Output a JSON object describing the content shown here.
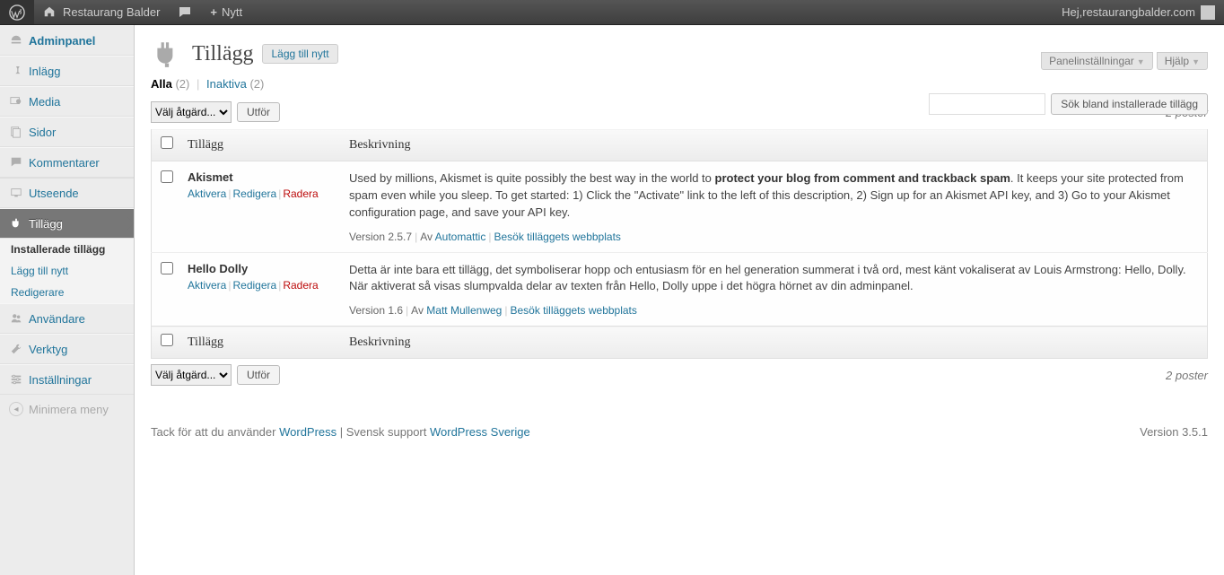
{
  "adminbar": {
    "site_name": "Restaurang Balder",
    "new_label": "Nytt",
    "howdy_prefix": "Hej, ",
    "user_display": "restaurangbalder.com"
  },
  "sidebar": {
    "items": [
      {
        "id": "dashboard",
        "label": "Adminpanel",
        "icon": "dashboard-icon"
      },
      {
        "id": "posts",
        "label": "Inlägg",
        "icon": "pin-icon"
      },
      {
        "id": "media",
        "label": "Media",
        "icon": "media-icon"
      },
      {
        "id": "pages",
        "label": "Sidor",
        "icon": "pages-icon"
      },
      {
        "id": "comments",
        "label": "Kommentarer",
        "icon": "comments-icon"
      },
      {
        "id": "appearance",
        "label": "Utseende",
        "icon": "appearance-icon"
      },
      {
        "id": "plugins",
        "label": "Tillägg",
        "icon": "plugins-icon",
        "current": true
      },
      {
        "id": "users",
        "label": "Användare",
        "icon": "users-icon"
      },
      {
        "id": "tools",
        "label": "Verktyg",
        "icon": "tools-icon"
      },
      {
        "id": "settings",
        "label": "Inställningar",
        "icon": "settings-icon"
      }
    ],
    "plugins_submenu": {
      "installed": "Installerade tillägg",
      "add_new": "Lägg till nytt",
      "editor": "Redigerare"
    },
    "collapse_label": "Minimera meny"
  },
  "screen_meta": {
    "screen_options": "Panelinställningar",
    "help": "Hjälp"
  },
  "header": {
    "title": "Tillägg",
    "add_new": "Lägg till nytt"
  },
  "filters": {
    "all_label": "Alla",
    "all_count": "(2)",
    "inactive_label": "Inaktiva",
    "inactive_count": "(2)"
  },
  "search": {
    "button": "Sök bland installerade tillägg"
  },
  "bulk": {
    "select_placeholder": "Välj åtgärd...",
    "apply": "Utför"
  },
  "table": {
    "col_plugin": "Tillägg",
    "col_desc": "Beskrivning",
    "items_count_label": "2 poster"
  },
  "row_actions": {
    "activate": "Aktivera",
    "edit": "Redigera",
    "delete": "Radera"
  },
  "plugins": [
    {
      "name": "Akismet",
      "desc_pre": "Used by millions, Akismet is quite possibly the best way in the world to ",
      "desc_strong": "protect your blog from comment and trackback spam",
      "desc_mid": ". It keeps your site protected from spam even while you sleep. To get started: 1) Click the \"Activate\" link to the left of this description, 2) ",
      "desc_link": "Sign up for an Akismet API key",
      "desc_post": ", and 3) Go to your Akismet configuration page, and save your API key.",
      "version_label": "Version 2.5.7",
      "author_prefix": "Av ",
      "author": "Automattic",
      "visit_site": "Besök tilläggets webbplats"
    },
    {
      "name": "Hello Dolly",
      "desc_full": "Detta är inte bara ett tillägg, det symboliserar hopp och entusiasm för en hel generation summerat i två ord, mest känt vokaliserat av Louis Armstrong: Hello, Dolly. När aktiverat så visas slumpvalda delar av texten från Hello, Dolly uppe i det högra hörnet av din adminpanel.",
      "version_label": "Version 1.6",
      "author_prefix": "Av ",
      "author": "Matt Mullenweg",
      "visit_site": "Besök tilläggets webbplats"
    }
  ],
  "footer": {
    "thanks_pre": "Tack för att du använder ",
    "wp_link": "WordPress",
    "sep": " | ",
    "support_pre": "Svensk support ",
    "support_link": "WordPress Sverige",
    "version": "Version 3.5.1"
  }
}
